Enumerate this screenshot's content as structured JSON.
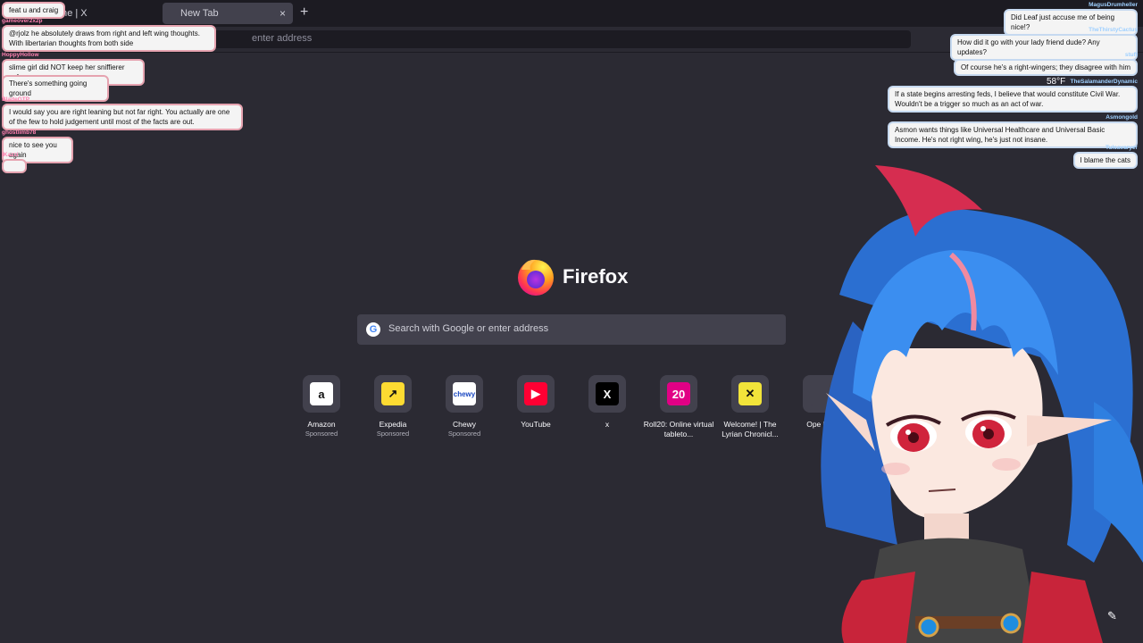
{
  "browser": {
    "tab1_label": "Home | X",
    "tab2_label": "New Tab",
    "tab_close": "×",
    "new_tab": "+",
    "url_placeholder": "enter address"
  },
  "newtab": {
    "brand": "Firefox",
    "search_placeholder": "Search with Google or enter address",
    "google_glyph": "G",
    "sites": [
      {
        "label": "Amazon",
        "sponsored": "Sponsored",
        "glyph": "a",
        "color": "#ffffff",
        "fg": "#111111"
      },
      {
        "label": "Expedia",
        "sponsored": "Sponsored",
        "glyph": "↗",
        "color": "#fddb32",
        "fg": "#111111"
      },
      {
        "label": "Chewy",
        "sponsored": "Sponsored",
        "glyph": "chewy",
        "color": "#ffffff",
        "fg": "#1c49c2"
      },
      {
        "label": "YouTube",
        "sponsored": "",
        "glyph": "▶",
        "color": "#ff0033",
        "fg": "#ffffff"
      },
      {
        "label": "x",
        "sponsored": "",
        "glyph": "X",
        "color": "#000000",
        "fg": "#ffffff"
      },
      {
        "label": "Roll20: Online virtual tableto...",
        "sponsored": "",
        "glyph": "20",
        "color": "#e10085",
        "fg": "#ffffff"
      },
      {
        "label": "Welcome! | The Lyrian Chronicl...",
        "sponsored": "",
        "glyph": "✕",
        "color": "#f2e43a",
        "fg": "#111111"
      },
      {
        "label": "Ope Pan",
        "sponsored": "",
        "glyph": "",
        "color": "#42414d",
        "fg": "#ffffff"
      }
    ]
  },
  "chat_left": [
    {
      "user": "",
      "text": "feat u and craig"
    },
    {
      "user": "gameover2x2p",
      "text": "@rjolz he absolutely draws from right and left wing thoughts. With libertarian thoughts from both side"
    },
    {
      "user": "HoppyHollow",
      "text": "slime girl did NOT keep her sniffierer safe"
    },
    {
      "user": "",
      "text": "There's something going ground"
    },
    {
      "user": "BladeGTP",
      "text": "I would say you are right leaning but not far right. You actually are one of the few to hold judgement until most of the facts are out."
    },
    {
      "user": "ghostlimb78",
      "text": "nice to see you again"
    },
    {
      "user": "iKazzi",
      "text": ""
    }
  ],
  "chat_right": [
    {
      "user": "MagusDrumheller",
      "text": "Did Leaf just accuse me of being nice!?"
    },
    {
      "user": "TheThirstyCactus",
      "text": "How did it go with your lady friend dude? Any updates?"
    },
    {
      "user": "stuft",
      "text": "Of course he's a right-wingers; they disagree with him"
    },
    {
      "user": "TheSalamanderDynamic",
      "text": "If a state begins arresting feds, I believe that would constitute Civil War. Wouldn't be a trigger so much as an act of war."
    },
    {
      "user": "Asmongold",
      "text": "Asmon wants things like Universal Healthcare and Universal Basic Income. He's not right wing, he's just not insane."
    },
    {
      "user": "Tulcavaryer",
      "text": "I blame the cats"
    }
  ],
  "weather": "58°F",
  "colors": {
    "background": "#2b2a33",
    "chrome": "#1c1b22",
    "tile": "#42414d",
    "hair": "#2f7fe0",
    "eyes": "#d0243c"
  }
}
